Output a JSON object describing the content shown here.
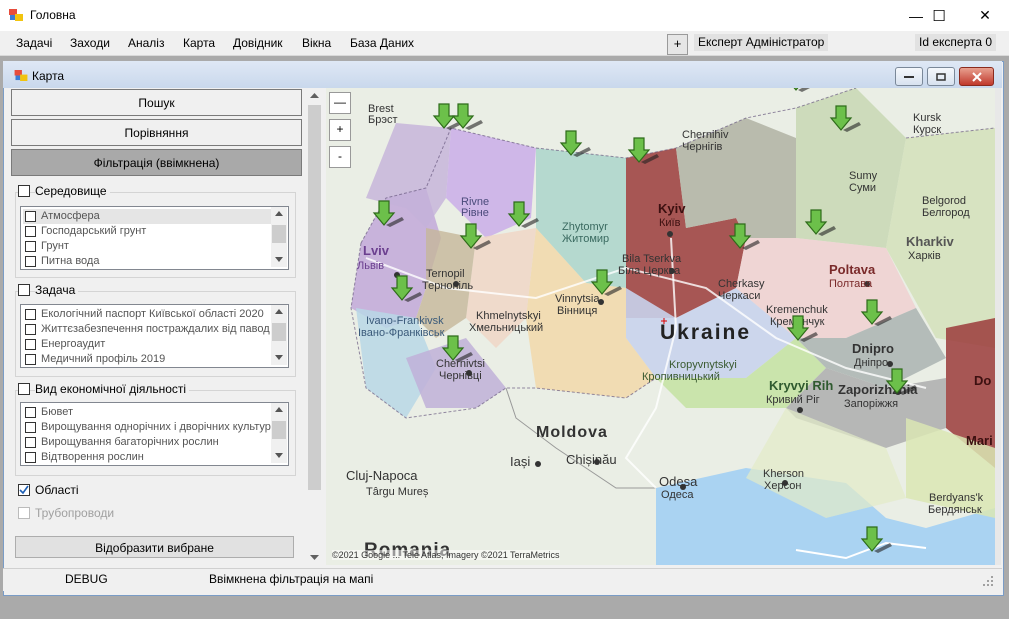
{
  "window": {
    "title": "Головна",
    "minimize": "—",
    "maximize": "☐",
    "close": "✕"
  },
  "menu": [
    "Задачі",
    "Заходи",
    "Аналіз",
    "Карта",
    "Довідник",
    "Вікна",
    "База Даних"
  ],
  "toolbar": {
    "plus": "+",
    "expert": "Експерт Адміністратор",
    "expert_id": "Id експерта 0"
  },
  "child": {
    "title": "Карта"
  },
  "panel": {
    "search_btn": "Пошук",
    "compare_btn": "Порівняння",
    "filter_btn": "Фільтрація (ввімкнена)",
    "env": {
      "label": "Середовище",
      "items": [
        "Атмосфера",
        "Господарський грунт",
        "Грунт",
        "Питна вода"
      ]
    },
    "task": {
      "label": "Задача",
      "items": [
        "Екологічний паспорт Київської області 2020",
        "Життєзабезпечення постраждалих від павод",
        "Енергоаудит",
        "Медичний профіль 2019"
      ]
    },
    "econ": {
      "label": "Вид економічної діяльності",
      "items": [
        "Бювет",
        "Вирощування однорічних і дворічних культур",
        "Вирощування багаторічних рослин",
        "Відтворення рослин"
      ]
    },
    "regions": {
      "label": "Області",
      "checked": true
    },
    "pipes": {
      "label": "Трубопроводи",
      "checked": false
    },
    "show_btn": "Відобразити вибране"
  },
  "map": {
    "zoom_controls": [
      "—",
      "+",
      "-"
    ],
    "country": "Ukraine",
    "country2": "Moldova",
    "country3": "Romania",
    "attribution": "©2021 Google ... Tele Atlas, Imagery ©2021 TerraMetrics",
    "labels": [
      {
        "t": "Brest"
      },
      {
        "t": "Брэст"
      },
      {
        "t": "Rivne"
      },
      {
        "t": "Рівне"
      },
      {
        "t": "Lviv"
      },
      {
        "t": "Львів"
      },
      {
        "t": "Ternopil"
      },
      {
        "t": "Тернопіль"
      },
      {
        "t": "Zhytomyr"
      },
      {
        "t": "Житомир"
      },
      {
        "t": "Kyiv"
      },
      {
        "t": "Київ"
      },
      {
        "t": "Chernihiv"
      },
      {
        "t": "Чернігів"
      },
      {
        "t": "Sumy"
      },
      {
        "t": "Суми"
      },
      {
        "t": "Kursk"
      },
      {
        "t": "Курск"
      },
      {
        "t": "Belgorod"
      },
      {
        "t": "Белгород"
      },
      {
        "t": "Kharkiv"
      },
      {
        "t": "Харків"
      },
      {
        "t": "Poltava"
      },
      {
        "t": "Полтава"
      },
      {
        "t": "Bila Tserkva"
      },
      {
        "t": "Біла Церква"
      },
      {
        "t": "Khmelnytskyi"
      },
      {
        "t": "Хмельницький"
      },
      {
        "t": "Ivano-Frankivsk"
      },
      {
        "t": "Івано-Франківськ"
      },
      {
        "t": "Vinnytsia"
      },
      {
        "t": "Вінниця"
      },
      {
        "t": "Cherkasy"
      },
      {
        "t": "Черкаси"
      },
      {
        "t": "Kremenchuk"
      },
      {
        "t": "Кременчук"
      },
      {
        "t": "Chernivtsi"
      },
      {
        "t": "Чернівці"
      },
      {
        "t": "Kropyvnytskyi"
      },
      {
        "t": "Кропивницький"
      },
      {
        "t": "Dnipro"
      },
      {
        "t": "Дніпро"
      },
      {
        "t": "Kryvyi Rih"
      },
      {
        "t": "Кривий Ріг"
      },
      {
        "t": "Zaporizhzhia"
      },
      {
        "t": "Запоріжжя"
      },
      {
        "t": "Iași"
      },
      {
        "t": "Chișinău"
      },
      {
        "t": "Cluj-Napoca"
      },
      {
        "t": "Târgu Mureș"
      },
      {
        "t": "Odesa"
      },
      {
        "t": "Одеса"
      },
      {
        "t": "Kherson"
      },
      {
        "t": "Херсон"
      },
      {
        "t": "Berdyans'k"
      },
      {
        "t": "Бердянськ"
      },
      {
        "t": "Mari"
      },
      {
        "t": "Do"
      }
    ]
  },
  "status": {
    "debug": "DEBUG",
    "message": "Ввімкнена фільтрація на мапі"
  }
}
